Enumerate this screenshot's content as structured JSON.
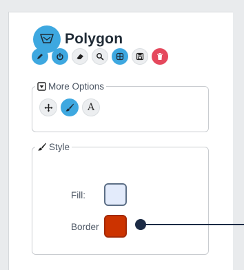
{
  "title": "Polygon",
  "toolbar": {
    "buttons": [
      {
        "icon": "pencil-icon",
        "name": "edit-button",
        "style": "blue"
      },
      {
        "icon": "power-icon",
        "name": "power-button",
        "style": "blue"
      },
      {
        "icon": "eraser-icon",
        "name": "eraser-button",
        "style": "light"
      },
      {
        "icon": "search-icon",
        "name": "search-button",
        "style": "light"
      },
      {
        "icon": "grid-icon",
        "name": "grid-button",
        "style": "blue"
      },
      {
        "icon": "save-icon",
        "name": "save-button",
        "style": "light"
      },
      {
        "icon": "trash-icon",
        "name": "delete-button",
        "style": "red"
      }
    ]
  },
  "more_options": {
    "label": "More Options",
    "buttons": [
      {
        "icon": "move-icon",
        "name": "move-button"
      },
      {
        "icon": "brush-icon",
        "name": "brush-button"
      },
      {
        "icon": "text-icon",
        "name": "text-button",
        "letter": "A"
      }
    ]
  },
  "style": {
    "label": "Style",
    "fill_label": "Fill:",
    "border_label": "Border",
    "fill_color": "#e3ebfb",
    "border_color": "#cc3300"
  },
  "colors": {
    "accent": "#3ea8e0",
    "danger": "#e5485d",
    "line": "#1c2b45"
  }
}
